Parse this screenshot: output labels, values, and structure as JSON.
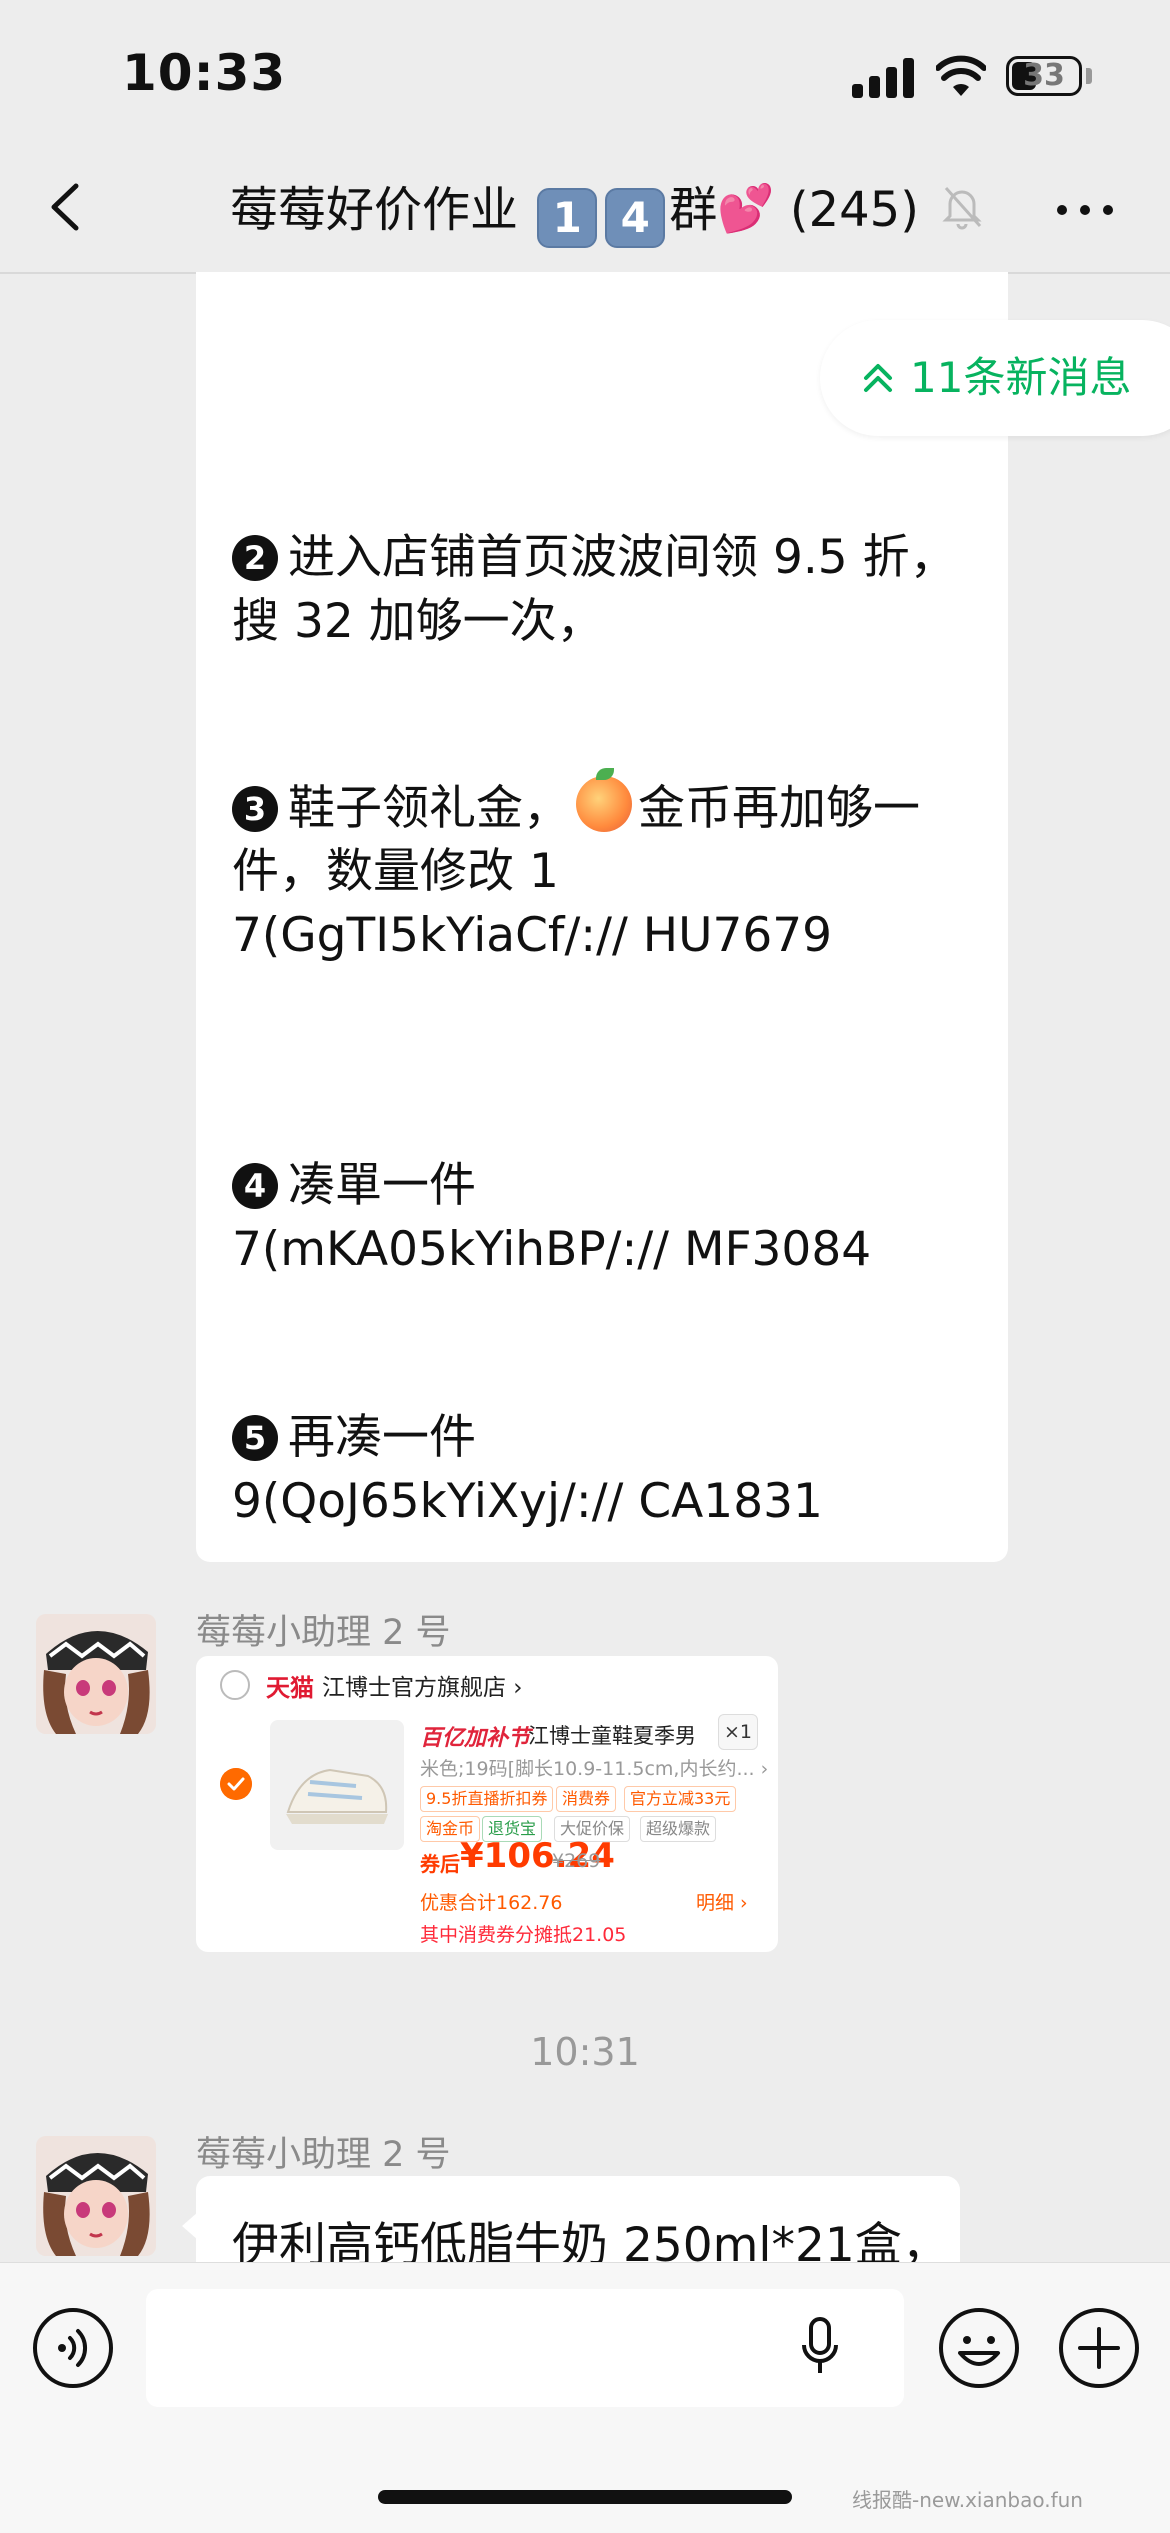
{
  "status_bar": {
    "time": "10:33",
    "battery": "33"
  },
  "nav": {
    "title_prefix": "莓莓好价作业",
    "num_1": "1",
    "num_2": "4",
    "title_group": "群",
    "member_count": "(245)"
  },
  "new_messages": {
    "label": "11条新消息"
  },
  "message_main": {
    "steps": [
      {
        "num": "2",
        "line1": "进入店铺首页波波间领 9.5 折，",
        "line2": "搜 32 加够一次，"
      },
      {
        "num": "3",
        "line1_a": "鞋子领礼金，",
        "line1_b": "金币再加够一",
        "line2": "件，数量修改 1",
        "line3": "7(GgTI5kYiaCf/:// HU7679"
      },
      {
        "num": "4",
        "line1": "凑單一件",
        "line2": "7(mKA05kYihBP/:// MF3084"
      },
      {
        "num": "5",
        "line1": "再凑一件",
        "line2": "9(QoJ65kYiXyj/:// CA1831"
      }
    ]
  },
  "sender": {
    "name": "莓莓小助理 2 号"
  },
  "product_card": {
    "platform": "天猫",
    "shop": "江博士官方旗舰店 ›",
    "promo_tag": "百亿加补节",
    "product_name": "江博士童鞋夏季男",
    "quantity": "×1",
    "spec": "米色;19码[脚长10.9-11.5cm,内长约... ›",
    "badges_row1": [
      "9.5折直播折扣券",
      "消费券",
      "官方立减33元"
    ],
    "badges_row2": [
      "淘金币",
      "退货宝",
      "大促价保",
      "超级爆款"
    ],
    "price_label": "券后",
    "price": "¥106.24",
    "original_price": "¥269",
    "discount_total": "优惠合计162.76",
    "detail_link": "明细 ›",
    "note": "其中消费券分摊抵21.05"
  },
  "time_divider": "10:31",
  "message_milk": {
    "text": "伊利高钙低脂牛奶 250ml*21盒，"
  },
  "watermark": "线报酷-new.xianbao.fun",
  "colors": {
    "accent_green": "#07b35f",
    "tmall_red": "#e01a32",
    "price_orange": "#ff3b00"
  }
}
